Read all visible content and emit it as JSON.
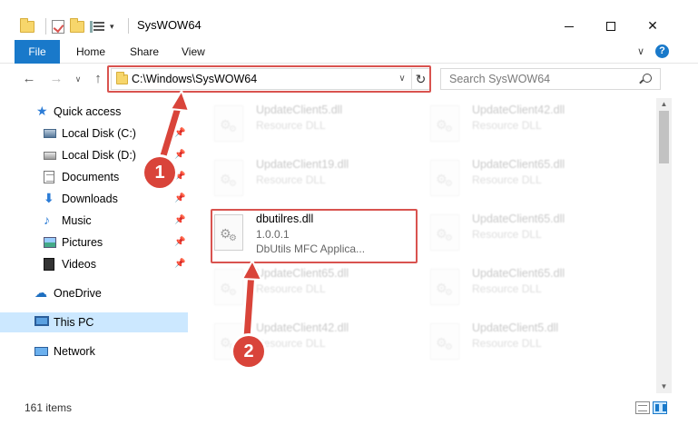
{
  "window": {
    "title": "SysWOW64",
    "qat_dropdown": "▾",
    "min": "",
    "max": "",
    "close": "✕"
  },
  "ribbon": {
    "file": "File",
    "home": "Home",
    "share": "Share",
    "view": "View",
    "chevron": "∨",
    "help": "?"
  },
  "nav": {
    "back": "←",
    "forward": "→",
    "recent": "∨",
    "up": "↑",
    "address": "C:\\Windows\\SysWOW64",
    "address_dropdown": "∨",
    "refresh": "↻",
    "search_placeholder": "Search SysWOW64"
  },
  "sidebar": {
    "items": [
      {
        "label": "Quick access",
        "pinned": false
      },
      {
        "label": "Local Disk (C:)",
        "pinned": true
      },
      {
        "label": "Local Disk (D:)",
        "pinned": true
      },
      {
        "label": "Documents",
        "pinned": true
      },
      {
        "label": "Downloads",
        "pinned": true
      },
      {
        "label": "Music",
        "pinned": true
      },
      {
        "label": "Pictures",
        "pinned": true
      },
      {
        "label": "Videos",
        "pinned": true
      },
      {
        "label": "OneDrive",
        "pinned": false
      },
      {
        "label": "This PC",
        "pinned": false
      },
      {
        "label": "Network",
        "pinned": false
      }
    ],
    "pin_glyph": "📌"
  },
  "files": [
    {
      "name": "UpdateClient5.dll",
      "type": "Resource DLL"
    },
    {
      "name": "UpdateClient42.dll",
      "type": "Resource DLL"
    },
    {
      "name": "UpdateClient19.dll",
      "type": "Resource DLL"
    },
    {
      "name": "UpdateClient65.dll",
      "type": "Resource DLL"
    },
    {
      "name": "dbutilres.dll",
      "version": "1.0.0.1",
      "description": "DbUtils MFC Applica..."
    },
    {
      "name": "UpdateClient65.dll",
      "type": "Resource DLL"
    },
    {
      "name": "UpdateClient65.dll",
      "type": "Resource DLL"
    },
    {
      "name": "UpdateClient65.dll",
      "type": "Resource DLL"
    },
    {
      "name": "UpdateClient42.dll",
      "type": "Resource DLL"
    },
    {
      "name": "UpdateClient5.dll",
      "type": "Resource DLL"
    }
  ],
  "scroll": {
    "up": "▲",
    "down": "▼"
  },
  "status": {
    "items": "161 items"
  },
  "annotations": {
    "step1": "1",
    "step2": "2"
  },
  "colors": {
    "accent": "#1979ca",
    "highlight": "#d9534f",
    "selected": "#cce8ff"
  }
}
